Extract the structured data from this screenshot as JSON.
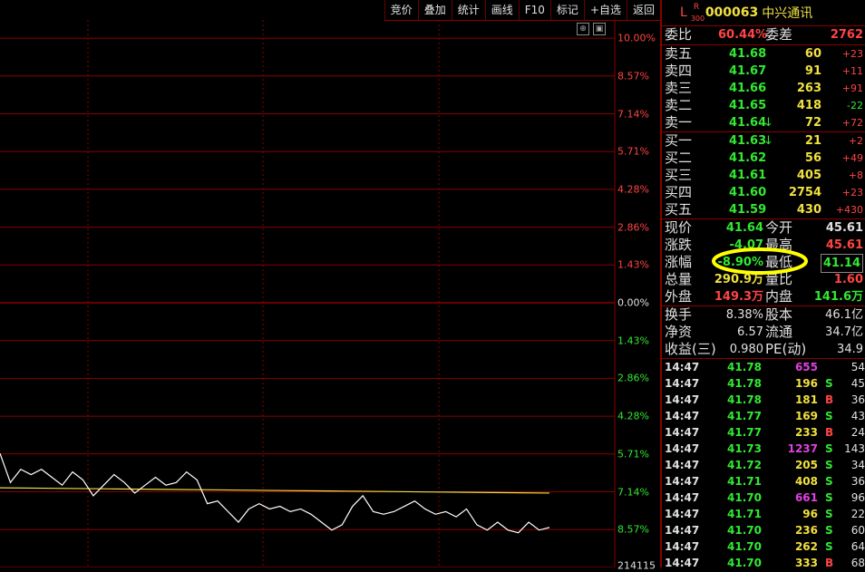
{
  "toolbar": {
    "buttons": [
      "竞价",
      "叠加",
      "统计",
      "画线",
      "F10",
      "标记",
      "+自选",
      "返回"
    ]
  },
  "y_labels_up": [
    "10.00%",
    "8.57%",
    "7.14%",
    "5.71%",
    "4.28%",
    "2.86%",
    "1.43%"
  ],
  "y_label_zero": "0.00%",
  "y_labels_down": [
    "1.43%",
    "2.86%",
    "4.28%",
    "5.71%",
    "7.14%",
    "8.57%"
  ],
  "y_label_bottom": "214115",
  "stock": {
    "market": "L",
    "sup": "R",
    "sub": "300",
    "code": "000063",
    "name": "中兴通讯"
  },
  "weibi": {
    "label": "委比",
    "value": "60.44%",
    "label2": "委差",
    "value2": "2762"
  },
  "sells": [
    {
      "label": "卖五",
      "price": "41.68",
      "vol": "60",
      "chg": "+23"
    },
    {
      "label": "卖四",
      "price": "41.67",
      "vol": "91",
      "chg": "+11"
    },
    {
      "label": "卖三",
      "price": "41.66",
      "vol": "263",
      "chg": "+91"
    },
    {
      "label": "卖二",
      "price": "41.65",
      "vol": "418",
      "chg": "-22"
    },
    {
      "label": "卖一",
      "price": "41.64",
      "vol": "72",
      "chg": "+72"
    }
  ],
  "buys": [
    {
      "label": "买一",
      "price": "41.63",
      "vol": "21",
      "chg": "+2"
    },
    {
      "label": "买二",
      "price": "41.62",
      "vol": "56",
      "chg": "+49"
    },
    {
      "label": "买三",
      "price": "41.61",
      "vol": "405",
      "chg": "+8"
    },
    {
      "label": "买四",
      "price": "41.60",
      "vol": "2754",
      "chg": "+23"
    },
    {
      "label": "买五",
      "price": "41.59",
      "vol": "430",
      "chg": "+430"
    }
  ],
  "quote": [
    {
      "l1": "现价",
      "v1": "41.64",
      "l2": "今开",
      "v2": "45.61"
    },
    {
      "l1": "涨跌",
      "v1": "-4.07",
      "l2": "最高",
      "v2": "45.61"
    },
    {
      "l1": "涨幅",
      "v1": "-8.90%",
      "l2": "最低",
      "v2": "41.14"
    },
    {
      "l1": "总量",
      "v1": "290.9万",
      "l2": "量比",
      "v2": "1.60"
    },
    {
      "l1": "外盘",
      "v1": "149.3万",
      "l2": "内盘",
      "v2": "141.6万"
    }
  ],
  "stats": [
    {
      "l1": "换手",
      "v1": "8.38%",
      "l2": "股本",
      "v2": "46.1亿"
    },
    {
      "l1": "净资",
      "v1": "6.57",
      "l2": "流通",
      "v2": "34.7亿"
    },
    {
      "l1": "收益(三)",
      "v1": "0.980",
      "l2": "PE(动)",
      "v2": "34.9"
    }
  ],
  "ticks": [
    {
      "time": "14:47",
      "price": "41.78",
      "vol": "655",
      "side": "",
      "num": "54",
      "volcolor": "magenta"
    },
    {
      "time": "14:47",
      "price": "41.78",
      "vol": "196",
      "side": "S",
      "num": "45",
      "volcolor": "yellow"
    },
    {
      "time": "14:47",
      "price": "41.78",
      "vol": "181",
      "side": "B",
      "num": "36",
      "volcolor": "yellow"
    },
    {
      "time": "14:47",
      "price": "41.77",
      "vol": "169",
      "side": "S",
      "num": "43",
      "volcolor": "yellow"
    },
    {
      "time": "14:47",
      "price": "41.77",
      "vol": "233",
      "side": "B",
      "num": "24",
      "volcolor": "yellow"
    },
    {
      "time": "14:47",
      "price": "41.73",
      "vol": "1237",
      "side": "S",
      "num": "143",
      "volcolor": "magenta"
    },
    {
      "time": "14:47",
      "price": "41.72",
      "vol": "205",
      "side": "S",
      "num": "34",
      "volcolor": "yellow"
    },
    {
      "time": "14:47",
      "price": "41.71",
      "vol": "408",
      "side": "S",
      "num": "36",
      "volcolor": "yellow"
    },
    {
      "time": "14:47",
      "price": "41.70",
      "vol": "661",
      "side": "S",
      "num": "96",
      "volcolor": "magenta"
    },
    {
      "time": "14:47",
      "price": "41.71",
      "vol": "96",
      "side": "S",
      "num": "22",
      "volcolor": "yellow"
    },
    {
      "time": "14:47",
      "price": "41.70",
      "vol": "236",
      "side": "S",
      "num": "60",
      "volcolor": "yellow"
    },
    {
      "time": "14:47",
      "price": "41.70",
      "vol": "262",
      "side": "S",
      "num": "64",
      "volcolor": "yellow"
    },
    {
      "time": "14:47",
      "price": "41.70",
      "vol": "333",
      "side": "B",
      "num": "68",
      "volcolor": "yellow"
    }
  ],
  "colors": {
    "up": "#ff4444",
    "down": "#32e832",
    "grid": "#8b0000",
    "avg": "#f0e040",
    "line": "#ffffff",
    "highlight": "#ffff00"
  },
  "chart_data": {
    "type": "line",
    "series_price_pct": [
      -5.7,
      -6.8,
      -6.3,
      -6.5,
      -6.3,
      -6.6,
      -6.9,
      -6.4,
      -6.7,
      -7.3,
      -6.9,
      -6.5,
      -6.8,
      -7.2,
      -6.9,
      -6.6,
      -6.9,
      -6.8,
      -6.4,
      -6.7,
      -7.6,
      -7.5,
      -7.9,
      -8.3,
      -7.8,
      -7.6,
      -7.8,
      -7.7,
      -7.9,
      -7.8,
      -8.0,
      -8.3,
      -8.6,
      -8.4,
      -7.7,
      -7.3,
      -7.9,
      -8.0,
      -7.9,
      -7.7,
      -7.5,
      -7.8,
      -8.0,
      -7.9,
      -8.1,
      -7.8,
      -8.4,
      -8.6,
      -8.3,
      -8.6,
      -8.7,
      -8.3,
      -8.6,
      -8.5
    ],
    "series_avg_pct": [
      -7.0,
      -7.02,
      -7.04,
      -7.06,
      -7.08,
      -7.1,
      -7.12,
      -7.14,
      -7.16,
      -7.18,
      -7.2
    ],
    "ylim": [
      -10,
      10
    ]
  }
}
